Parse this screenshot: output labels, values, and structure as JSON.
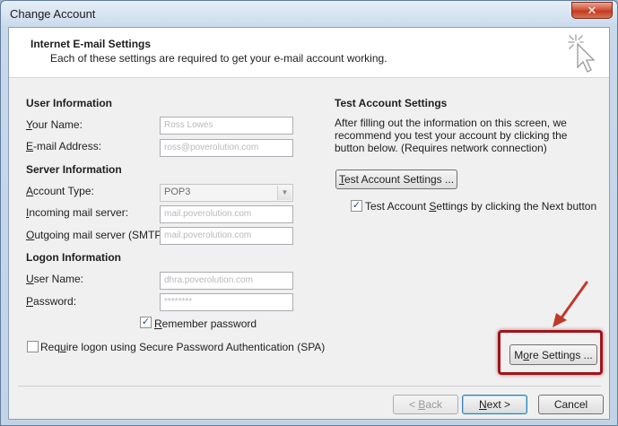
{
  "window": {
    "title": "Change Account",
    "close_glyph": "✕"
  },
  "header": {
    "title": "Internet E-mail Settings",
    "subtitle": "Each of these settings are required to get your e-mail account working.",
    "icon": "wizard-cursor-icon"
  },
  "user_info": {
    "heading": "User Information",
    "your_name": {
      "accel": "Y",
      "rest": "our Name:",
      "value": "Ross Lowes"
    },
    "email": {
      "accel": "E",
      "rest": "-mail Address:",
      "value": "ross@poverolution.com"
    }
  },
  "server_info": {
    "heading": "Server Information",
    "account_type": {
      "pre": "",
      "accel": "A",
      "rest": "ccount Type:",
      "value": "POP3"
    },
    "incoming": {
      "accel": "I",
      "rest": "ncoming mail server:",
      "value": "mail.poverolution.com"
    },
    "outgoing": {
      "accel": "O",
      "rest": "utgoing mail server (SMTP):",
      "value": "mail.poverolution.com"
    }
  },
  "logon_info": {
    "heading": "Logon Information",
    "user_name": {
      "accel": "U",
      "rest": "ser Name:",
      "value": "dhra.poverolution.com"
    },
    "password": {
      "accel": "P",
      "rest": "assword:",
      "value": "********"
    },
    "remember": {
      "checked": "✓",
      "accel": "R",
      "rest": "emember password"
    },
    "spa": {
      "pre": "Req",
      "accel": "u",
      "rest": "ire logon using Secure Password Authentication (SPA)"
    }
  },
  "test": {
    "heading": "Test Account Settings",
    "description": "After filling out the information on this screen, we recommend you test your account by clicking the button below. (Requires network connection)",
    "button": {
      "accel": "T",
      "rest": "est Account Settings ..."
    },
    "checkbox": {
      "checked": "✓",
      "pre": "Test Account ",
      "accel": "S",
      "rest": "ettings by clicking the Next button"
    }
  },
  "more_settings": {
    "pre": "M",
    "accel": "o",
    "rest": "re Settings ..."
  },
  "footer": {
    "back": {
      "pre": "< ",
      "accel": "B",
      "rest": "ack"
    },
    "next": {
      "accel": "N",
      "rest": "ext >"
    },
    "cancel": "Cancel"
  },
  "colors": {
    "highlight_box": "#a3121a",
    "arrow": "#c0392b"
  }
}
